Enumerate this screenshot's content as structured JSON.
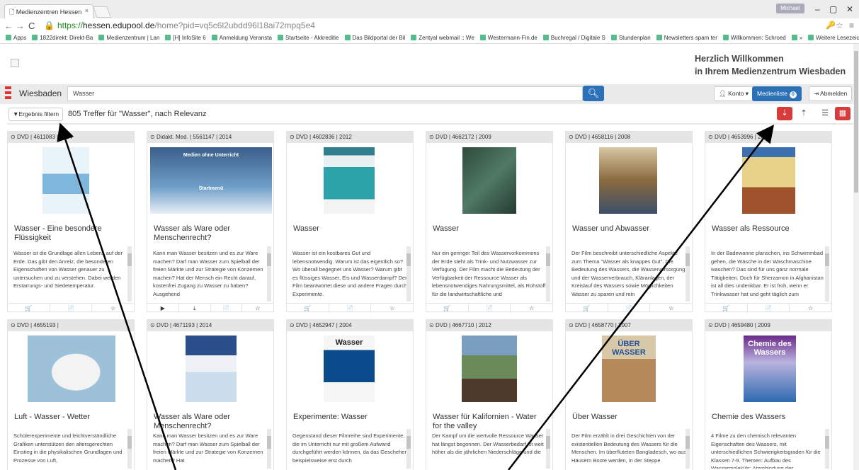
{
  "browser": {
    "tab_title": "Medienzentren Hessen",
    "tab_close": "×",
    "user_badge": "Michael",
    "url_https": "https://",
    "url_host": "hessen.edupool.de",
    "url_path": "/home?pid=vq5c6l2ubdd96l18ai72mpq5e4",
    "bookmarks": [
      "Apps",
      "1822direkt: Direkt-Ba",
      "Medienzentrum | Lan",
      "[H] InfoSite 6",
      "Anmeldung Veransta",
      "Startseite - Akkreditie",
      "Das Bildportal der Bil",
      "Zentyal webmail :: We",
      "Westermann-Fin.de",
      "Buchregal / Digitale S",
      "Stundenplan",
      "Newsletters spam ter",
      "Willkommen: Schroed",
      "»",
      "Weitere Lesezeichen"
    ]
  },
  "header": {
    "welcome_line1": "Herzlich Willkommen",
    "welcome_line2": "in Ihrem Medienzentrum Wiesbaden"
  },
  "search": {
    "city": "Wiesbaden",
    "query": "Wasser",
    "konto_label": "Konto",
    "medienliste_label": "Medienliste",
    "medienliste_count": "0",
    "abmelden_label": "Abmelden"
  },
  "results": {
    "filter_label": "Ergebnis filtern",
    "hits_text": "805 Treffer für \"Wasser\", nach Relevanz"
  },
  "cards": [
    {
      "head": "DVD | 4611083 | 2014",
      "title": "Wasser - Eine besondere Flüssigkeit",
      "desc": "Wasser ist die Grundlage allen Lebens auf der Erde. Das gibt den Anreiz, die besonderen Eigenschaften von Wasser genauer zu untersuchen und zu verstehen. Dabei werden Erstarrungs- und Siedetemperatur.",
      "icons": [
        "🛒",
        "📄",
        "☆"
      ]
    },
    {
      "head": "Didakt. Med. | 5561147 | 2014",
      "title": "Wasser als Ware oder Menschenrecht?",
      "desc": "Kann man Wasser besitzen und es zur Ware machen? Darf man Wasser zum Spielball der freien Märkte und zur Strategie von Konzernen machen? Hat der Mensch ein Recht darauf, kostenfrei Zugang zu Wasser zu haben? Ausgehend",
      "icons": [
        "▶",
        "⤓",
        "📄",
        "☆"
      ]
    },
    {
      "head": "DVD | 4602836 | 2012",
      "title": "Wasser",
      "desc": "Wasser ist ein kostbares Gut und lebensnotwendig. Warum ist das eigentlich so? Wo überall begegnet uns Wasser? Warum gibt es flüssiges Wasser, Eis und Wasserdampf? Der Film beantwortet diese und andere Fragen durch Experimente.",
      "icons": [
        "🛒",
        "📄",
        "☆"
      ]
    },
    {
      "head": "DVD | 4662172 | 2009",
      "title": "Wasser",
      "desc": "Nur ein geringer Teil des Wasservorkommens der Erde steht als Trink- und Nutzwasser zur Verfügung. Der Film macht die Bedeutung der Verfügbarkeit der Ressource Wasser als lebensnotwendiges Nahrungsmittel, als Rohstoff für die landwirtschaftliche und",
      "icons": [
        "🛒",
        "📄",
        "☆"
      ]
    },
    {
      "head": "DVD | 4658116 | 2008",
      "title": "Wasser und Abwasser",
      "desc": "Der Film beschreibt unterschiedliche Aspekte zum Thema \"Wasser als knappes Gut\". Die Bedeutung des Wassers, die Wasserversorgung und der Wasserverbrauch, Kläranlagen, der Kreislauf des Wassers sowie Möglichkeiten Wasser zu sparen und rein",
      "icons": [
        "🛒",
        "📄",
        "☆"
      ]
    },
    {
      "head": "DVD | 4653996 | 2011",
      "title": "Wasser als Ressource",
      "desc": "In der Badewanne planschen, ins Schwimmbad gehen, die Wäsche in der Waschmaschine waschen? Das sind für uns ganz normale Tätigkeiten. Doch für Sherzamon in Afghanistan ist all dies undenkbar. Er ist froh, wenn er Trinkwasser hat und geht täglich zum",
      "icons": [
        "🛒",
        "📄",
        "☆"
      ]
    },
    {
      "head": "DVD | 4655193 |",
      "title": "Luft - Wasser - Wetter",
      "desc": "Schülerexperimente und leichtverständliche Grafiken unterstützen den altersgerechten Einstieg in die physikalischen Grundlagen und Prozesse von Luft,",
      "icons": []
    },
    {
      "head": "DVD | 4671193 | 2014",
      "title": "Wasser als Ware oder Menschenrecht?",
      "desc": "Kann man Wasser besitzen und es zur Ware machen? Darf man Wasser zum Spielball der freien Märkte und zur Strategie von Konzernen machen? Hat",
      "icons": []
    },
    {
      "head": "DVD | 4652947 | 2004",
      "title": "Experimente: Wasser",
      "desc": "Gegenstand dieser Filmreihe sind Experimente, die im Unterricht nur mit großem Aufwand durchgeführt werden können, da das Geschehen beispielsweise erst durch",
      "icons": []
    },
    {
      "head": "DVD | 4667710 | 2012",
      "title": "Wasser für Kalifornien - Water for the valley",
      "desc": "Der Kampf um die wertvolle Ressource Wasser hat längst begonnen. Der Wasserbedarf ist weit höher als die jährlichen Niederschläge und die",
      "icons": []
    },
    {
      "head": "DVD | 4658770 | 2007",
      "title": "Über Wasser",
      "desc": "Der Film erzählt in drei Geschichten von der existentiellen Bedeutung des Wassers für die Menschen. Im überfluteten Bangladesch, wo aus Häusern Boote werden, in der Steppe",
      "icons": []
    },
    {
      "head": "DVD | 4659480 | 2009",
      "title": "Chemie des Wassers",
      "desc": "4 Filme zu den chemisch relevanten Eigenschaften des Wassers, mit unterschiedlichen Schwierigkeitsgraden für die Klassen 7-9. Themen: Aufbau des Wassermoleküls: Atombindung des",
      "icons": []
    }
  ],
  "covers": {
    "c2_text1": "Medien ohne Unterricht",
    "c2_text2": "Startmenü",
    "c9_title": "Wasser",
    "c11_title": "ÜBER WASSER",
    "c12_title": "Chemie des Wassers"
  }
}
